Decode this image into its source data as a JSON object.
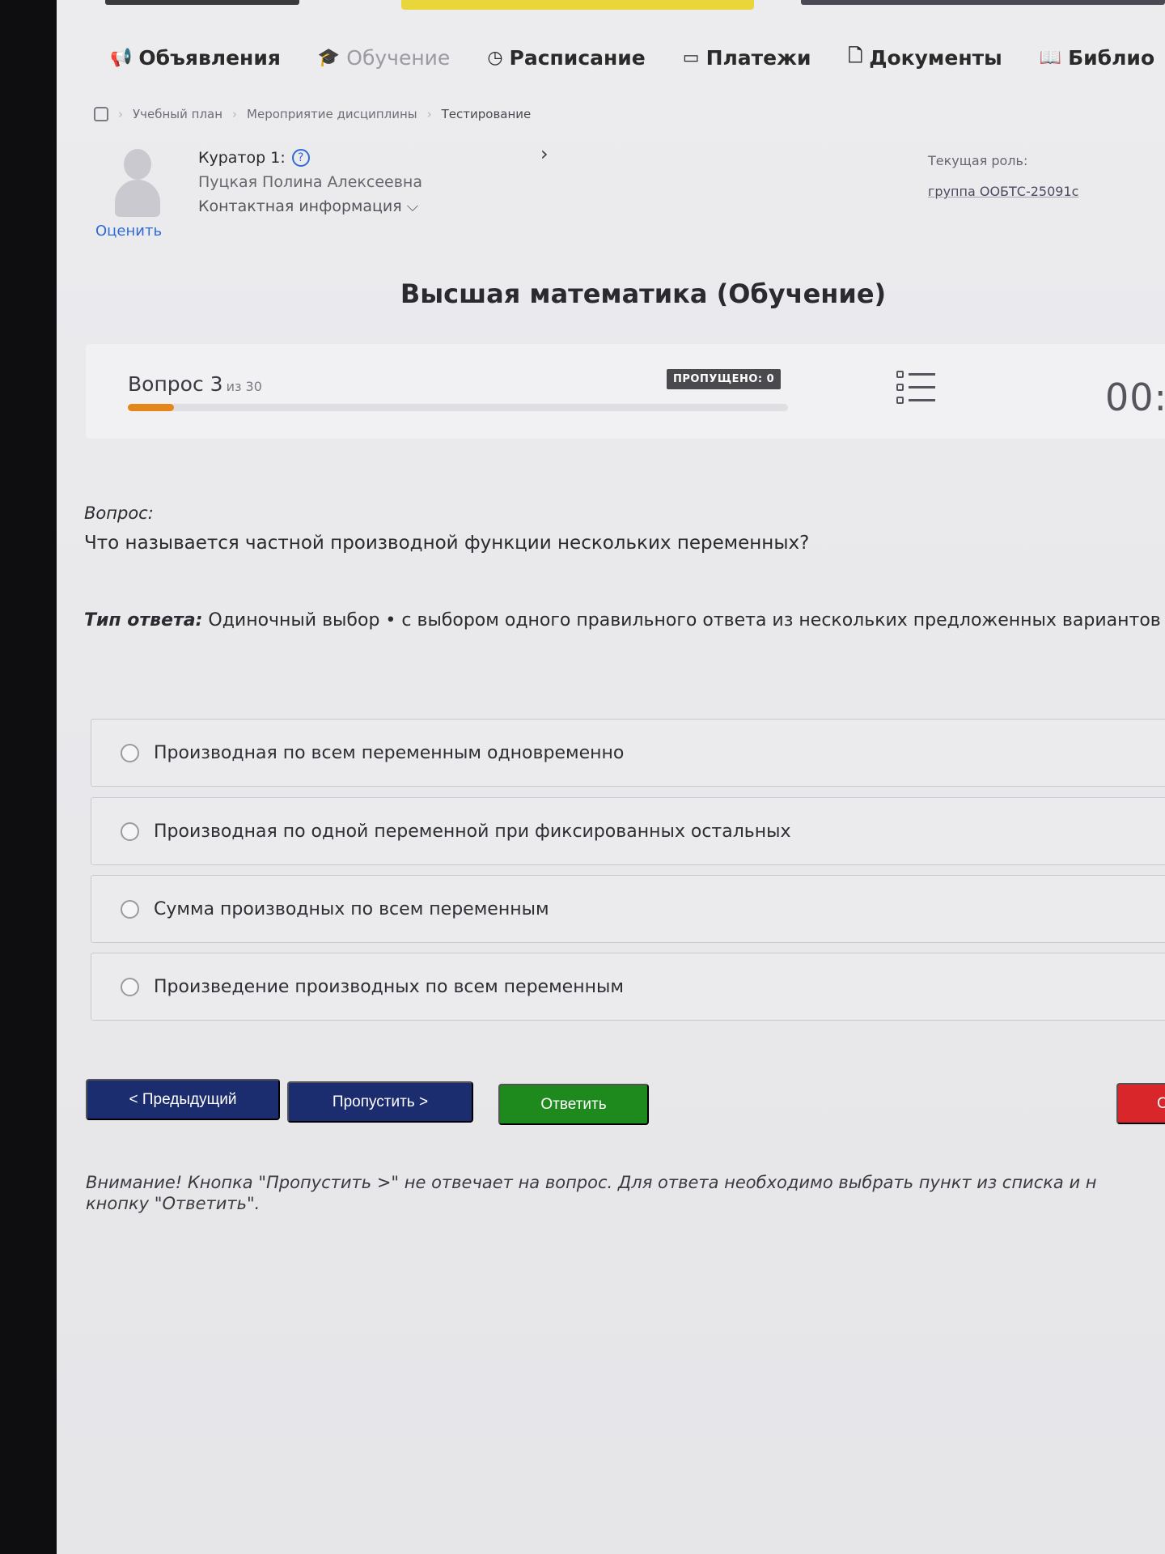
{
  "nav": {
    "items": [
      {
        "icon": "megaphone-icon",
        "glyph": "📢",
        "label": "Объявления"
      },
      {
        "icon": "graduation-cap-icon",
        "glyph": "🎓",
        "label": "Обучение"
      },
      {
        "icon": "clock-icon",
        "glyph": "◷",
        "label": "Расписание"
      },
      {
        "icon": "payment-card-icon",
        "glyph": "▭",
        "label": "Платежи"
      },
      {
        "icon": "document-icon",
        "glyph": "🗋",
        "label": "Документы"
      },
      {
        "icon": "book-icon",
        "glyph": "📖",
        "label": "Библио"
      }
    ]
  },
  "breadcrumb": {
    "items": [
      "Учебный план",
      "Мероприятие дисциплины",
      "Тестирование"
    ]
  },
  "curator": {
    "title": "Куратор 1:",
    "help_glyph": "?",
    "name": "Пуцкая Полина Алексеевна",
    "contact": "Контактная информация ⌵",
    "rate_link": "Оценить",
    "next_glyph": "›"
  },
  "role": {
    "label": "Текущая роль:",
    "group": "группа ООБТС-25091с"
  },
  "course_title": "Высшая математика (Обучение)",
  "progress": {
    "question_label": "Вопрос 3",
    "of_label": "из 30",
    "skipped_badge": "ПРОПУЩЕНО: 0",
    "fraction": 0.07,
    "timer": "00:",
    "accent": "#e4861a"
  },
  "question": {
    "heading": "Вопрос:",
    "text": "Что называется частной производной функции нескольких переменных?",
    "answer_type_label": "Тип ответа:",
    "answer_type_text": " Одиночный выбор • с выбором одного правильного ответа из нескольких предложенных вариантов"
  },
  "options": [
    "Производная по всем переменным одновременно",
    "Производная по одной переменной при фиксированных остальных",
    "Сумма производных по всем переменным",
    "Произведение производных по всем переменным"
  ],
  "buttons": {
    "prev": "< Предыдущий",
    "skip": "Пропустить >",
    "answer": "Ответить",
    "finish": "С"
  },
  "colors": {
    "nav_primary": "#1b2d6e",
    "answer_green": "#1e8a1e",
    "finish_red": "#d8262a",
    "link_blue": "#2f6bd8"
  },
  "warning": {
    "line1": "Внимание! Кнопка \"Пропустить >\" не отвечает на вопрос. Для ответа необходимо выбрать пункт из списка и н",
    "line2": "кнопку \"Ответить\"."
  }
}
